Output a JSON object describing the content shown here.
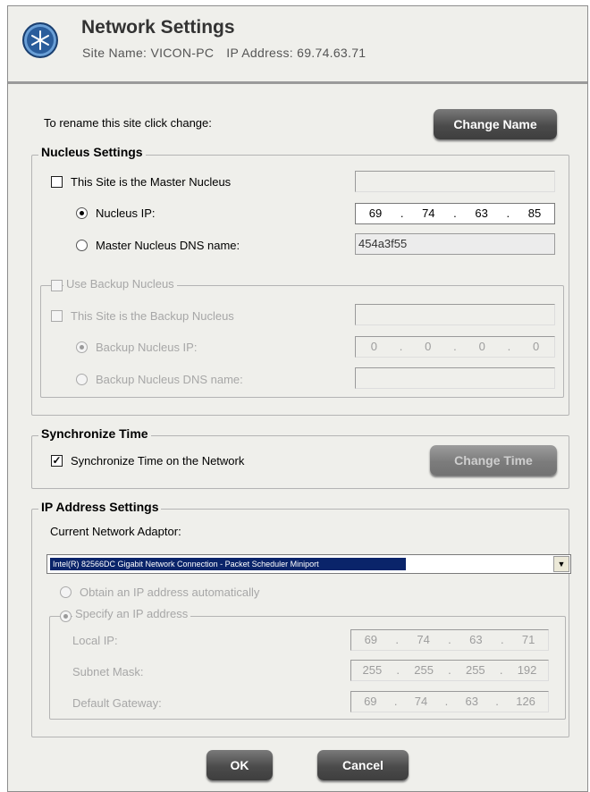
{
  "header": {
    "title": "Network Settings",
    "site_name": "Site Name: VICON-PC",
    "ip_address": "IP Address: 69.74.63.71"
  },
  "rename": {
    "label": "To rename this site click change:",
    "button": "Change Name"
  },
  "nucleus": {
    "legend": "Nucleus Settings",
    "master_checkbox": "This Site is the Master Nucleus",
    "master_checked": false,
    "master_field": "",
    "nucleus_ip_label": "Nucleus IP:",
    "nucleus_ip": [
      "69",
      "74",
      "63",
      "85"
    ],
    "dns_label": "Master Nucleus DNS name:",
    "dns_value": "454a3f55",
    "backup": {
      "legend": "Use Backup Nucleus",
      "backup_checkbox": "This Site is the Backup Nucleus",
      "backup_field": "",
      "backup_ip_label": "Backup Nucleus IP:",
      "backup_ip": [
        "0",
        "0",
        "0",
        "0"
      ],
      "backup_dns_label": "Backup Nucleus DNS name:",
      "backup_dns_value": ""
    }
  },
  "sync": {
    "legend": "Synchronize Time",
    "checkbox": "Synchronize Time on the Network",
    "checked": true,
    "button": "Change Time"
  },
  "ip_settings": {
    "legend": "IP Address Settings",
    "adaptor_label": "Current Network Adaptor:",
    "adaptor_value": "Intel(R) 82566DC Gigabit Network Connection - Packet Scheduler Miniport",
    "auto_label": "Obtain an IP address automatically",
    "specify_label": "Specify an IP address",
    "local_ip_label": "Local IP:",
    "local_ip": [
      "69",
      "74",
      "63",
      "71"
    ],
    "subnet_label": "Subnet Mask:",
    "subnet": [
      "255",
      "255",
      "255",
      "192"
    ],
    "gateway_label": "Default Gateway:",
    "gateway": [
      "69",
      "74",
      "63",
      "126"
    ]
  },
  "footer": {
    "ok": "OK",
    "cancel": "Cancel"
  },
  "icons": {
    "logo": "snowflake-logo-icon",
    "dropdown": "chevron-down-icon"
  }
}
